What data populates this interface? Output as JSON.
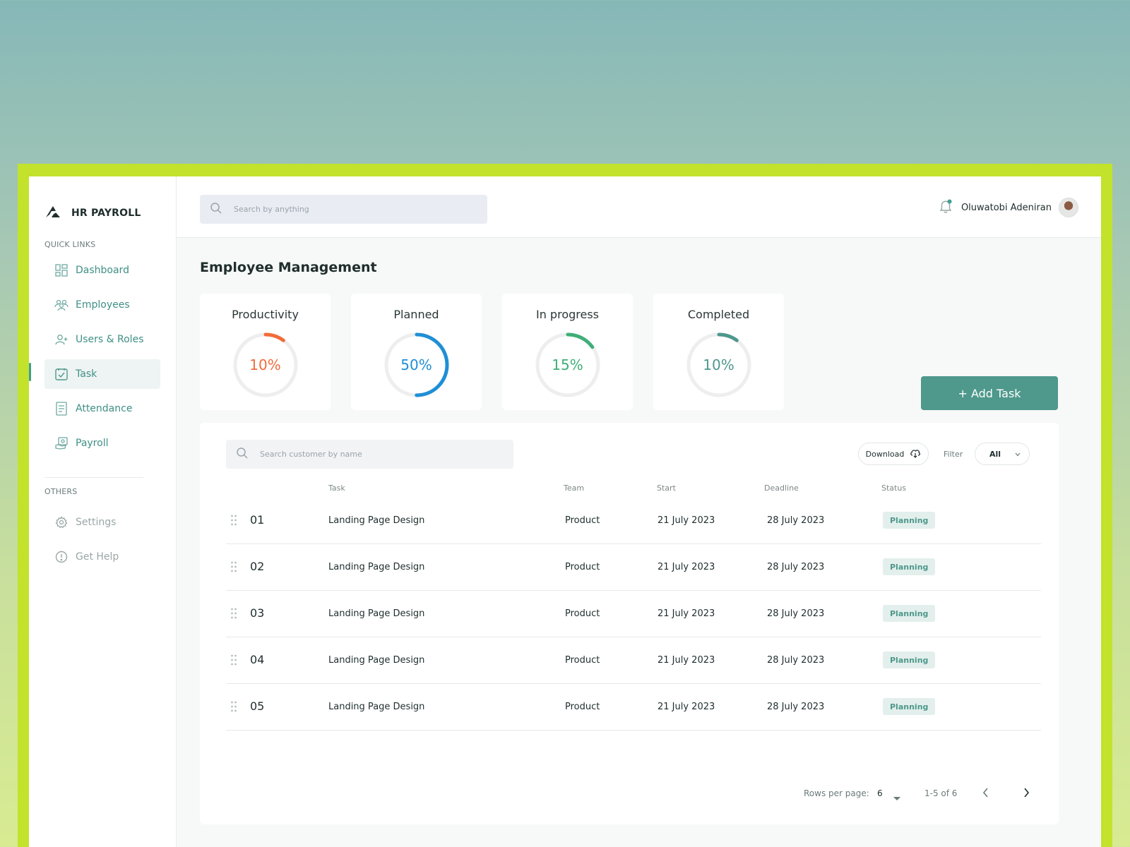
{
  "brand": {
    "title": "HR PAYROLL"
  },
  "sidebar": {
    "quick_links_label": "QUICK LINKS",
    "items": [
      {
        "label": "Dashboard",
        "icon": "dashboard-icon"
      },
      {
        "label": "Employees",
        "icon": "employees-icon"
      },
      {
        "label": "Users & Roles",
        "icon": "user-add-icon"
      },
      {
        "label": "Task",
        "icon": "task-icon",
        "active": true
      },
      {
        "label": "Attendance",
        "icon": "attendance-icon"
      },
      {
        "label": "Payroll",
        "icon": "payroll-icon"
      }
    ],
    "others_label": "OTHERS",
    "others": [
      {
        "label": "Settings",
        "icon": "gear-icon"
      },
      {
        "label": "Get Help",
        "icon": "help-icon"
      }
    ]
  },
  "header": {
    "search_placeholder": "Search by anything",
    "user_name": "Oluwatobi Adeniran"
  },
  "page": {
    "title": "Employee Management"
  },
  "stats": [
    {
      "title": "Productivity",
      "value": "10%",
      "percent": 10,
      "color": "#f26b3a"
    },
    {
      "title": "Planned",
      "value": "50%",
      "percent": 50,
      "color": "#1f8fd6"
    },
    {
      "title": "In progress",
      "value": "15%",
      "percent": 15,
      "color": "#3fae78"
    },
    {
      "title": "Completed",
      "value": "10%",
      "percent": 10,
      "color": "#4e988c"
    }
  ],
  "add_task_label": "+ Add Task",
  "table": {
    "search_placeholder": "Search customer by name",
    "download_label": "Download",
    "filter_label": "Filter",
    "filter_value": "All",
    "columns": [
      "Task",
      "Team",
      "Start",
      "Deadline",
      "Status"
    ],
    "rows": [
      {
        "num": "01",
        "task": "Landing Page Design",
        "team": "Product",
        "start": "21 July 2023",
        "deadline": "28 July 2023",
        "status": "Planning"
      },
      {
        "num": "02",
        "task": "Landing Page Design",
        "team": "Product",
        "start": "21 July 2023",
        "deadline": "28 July 2023",
        "status": "Planning"
      },
      {
        "num": "03",
        "task": "Landing Page Design",
        "team": "Product",
        "start": "21 July 2023",
        "deadline": "28 July 2023",
        "status": "Planning"
      },
      {
        "num": "04",
        "task": "Landing Page Design",
        "team": "Product",
        "start": "21 July 2023",
        "deadline": "28 July 2023",
        "status": "Planning"
      },
      {
        "num": "05",
        "task": "Landing Page Design",
        "team": "Product",
        "start": "21 July 2023",
        "deadline": "28 July 2023",
        "status": "Planning"
      }
    ],
    "pagination": {
      "rows_per_page_label": "Rows per page:",
      "rows_per_page": "6",
      "range": "1-5 of 6"
    }
  },
  "colors": {
    "accent": "#4e988c",
    "frame": "#c2e22c"
  }
}
